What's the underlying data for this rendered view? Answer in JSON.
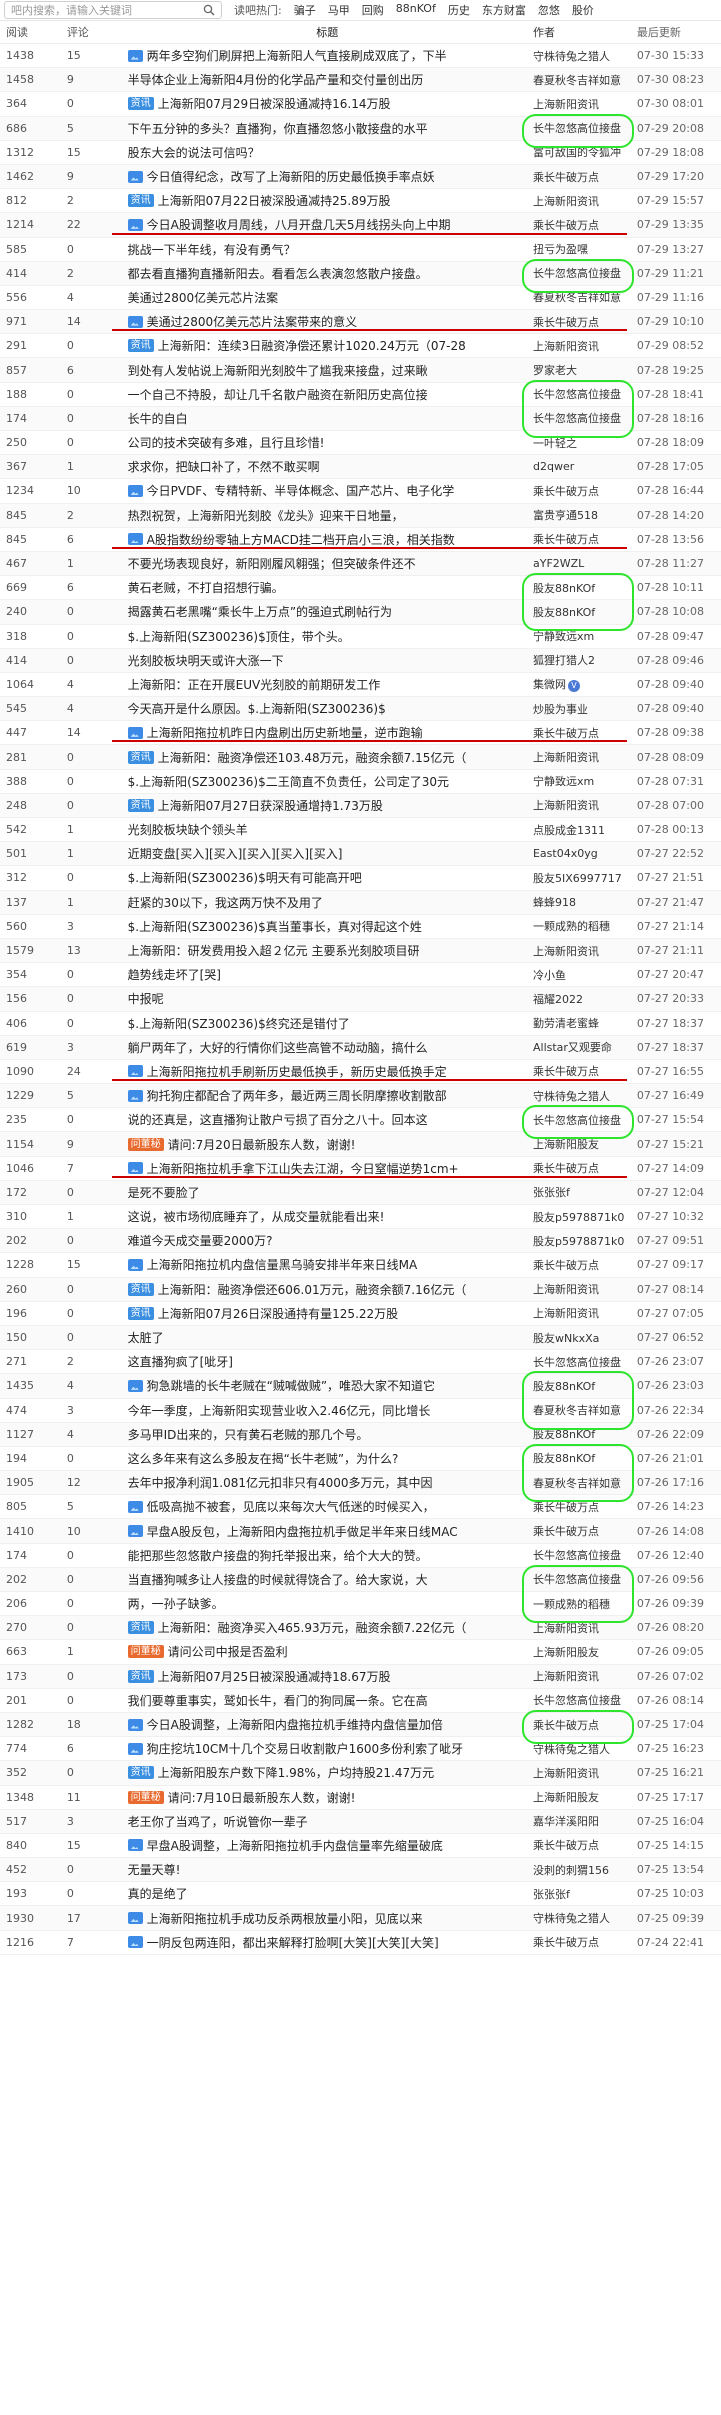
{
  "search": {
    "placeholder": "吧内搜索，请输入关键词"
  },
  "hot": {
    "label": "读吧热门:",
    "links": [
      "骗子",
      "马甲",
      "回购",
      "88nKOf",
      "历史",
      "东方财富",
      "忽悠",
      "股价"
    ]
  },
  "header": {
    "read": "阅读",
    "comment": "评论",
    "title": "标题",
    "author": "作者",
    "time": "最后更新"
  },
  "rows": [
    {
      "read": "1438",
      "cmt": "15",
      "icon": "pic",
      "title": "两年多空狗们刷屏把上海新阳人气直接刷成双底了，下半",
      "author": "守株待兔之猎人",
      "time": "07-30 15:33"
    },
    {
      "read": "1458",
      "cmt": "9",
      "icon": "",
      "title": "半导体企业上海新阳4月份的化学品产量和交付量创出历",
      "author": "春夏秋冬吉祥如意",
      "time": "07-30 08:23"
    },
    {
      "read": "364",
      "cmt": "0",
      "icon": "info",
      "title": "上海新阳07月29日被深股通减持16.14万股",
      "author": "上海新阳资讯",
      "time": "07-30 08:01"
    },
    {
      "read": "686",
      "cmt": "5",
      "icon": "",
      "title": "下午五分钟的多头？直播狗，你直播忽悠小散接盘的水平",
      "author": "长牛忽悠高位接盘",
      "time": "07-29 20:08"
    },
    {
      "read": "1312",
      "cmt": "15",
      "icon": "",
      "title": "股东大会的说法可信吗？",
      "author": "富可敌国的令狐冲",
      "time": "07-29 18:08"
    },
    {
      "read": "1462",
      "cmt": "9",
      "icon": "pic",
      "title": "今日值得纪念，改写了上海新阳的历史最低换手率点妖",
      "author": "乘长牛破万点",
      "time": "07-29 17:20"
    },
    {
      "read": "812",
      "cmt": "2",
      "icon": "info",
      "title": "上海新阳07月22日被深股通减持25.89万股",
      "author": "上海新阳资讯",
      "time": "07-29 15:57"
    },
    {
      "read": "1214",
      "cmt": "22",
      "icon": "pic",
      "title": "今日A股调整收月周线，八月开盘几天5月线拐头向上中期",
      "author": "乘长牛破万点",
      "time": "07-29 13:35"
    },
    {
      "read": "585",
      "cmt": "0",
      "icon": "",
      "title": "挑战一下半年线，有没有勇气？",
      "author": "扭亏为盈嘿",
      "time": "07-29 13:27"
    },
    {
      "read": "414",
      "cmt": "2",
      "icon": "",
      "title": "都去看直播狗直播新阳去。看看怎么表演忽悠散户接盘。",
      "author": "长牛忽悠高位接盘",
      "time": "07-29 11:21"
    },
    {
      "read": "556",
      "cmt": "4",
      "icon": "",
      "title": "美通过2800亿美元芯片法案",
      "author": "春夏秋冬吉祥如意",
      "time": "07-29 11:16"
    },
    {
      "read": "971",
      "cmt": "14",
      "icon": "pic",
      "title": "美通过2800亿美元芯片法案带来的意义",
      "author": "乘长牛破万点",
      "time": "07-29 10:10"
    },
    {
      "read": "291",
      "cmt": "0",
      "icon": "info",
      "title": "上海新阳：连续3日融资净偿还累计1020.24万元（07-28",
      "author": "上海新阳资讯",
      "time": "07-29 08:52"
    },
    {
      "read": "857",
      "cmt": "6",
      "icon": "",
      "title": "到处有人发帖说上海新阳光刻胶牛了尴我来接盘，过来瞅",
      "author": "罗家老大",
      "time": "07-28 19:25"
    },
    {
      "read": "188",
      "cmt": "0",
      "icon": "",
      "title": "一个自己不持股，却让几千名散户融资在新阳历史高位接",
      "author": "长牛忽悠高位接盘",
      "time": "07-28 18:41"
    },
    {
      "read": "174",
      "cmt": "0",
      "icon": "",
      "title": "长牛的自白",
      "author": "长牛忽悠高位接盘",
      "time": "07-28 18:16"
    },
    {
      "read": "250",
      "cmt": "0",
      "icon": "",
      "title": "公司的技术突破有多难，且行且珍惜!",
      "author": "一叶轻之",
      "time": "07-28 18:09"
    },
    {
      "read": "367",
      "cmt": "1",
      "icon": "",
      "title": "求求你，把缺口补了，不然不敢买啊",
      "author": "d2qwer",
      "time": "07-28 17:05"
    },
    {
      "read": "1234",
      "cmt": "10",
      "icon": "pic",
      "title": "今日PVDF、专精特新、半导体概念、国产芯片、电子化学",
      "author": "乘长牛破万点",
      "time": "07-28 16:44"
    },
    {
      "read": "845",
      "cmt": "2",
      "icon": "",
      "title": "热烈祝贺，上海新阳光刻胶《龙头》迎来干日地量，",
      "author": "富贵亨通518",
      "time": "07-28 14:20"
    },
    {
      "read": "845",
      "cmt": "6",
      "icon": "pic",
      "title": "A股指数纷纷零轴上方MACD挂二档开启小三浪，相关指数",
      "author": "乘长牛破万点",
      "time": "07-28 13:56"
    },
    {
      "read": "467",
      "cmt": "1",
      "icon": "",
      "title": "不要光场表现良好，新阳刚履风翱强；但突破条件还不",
      "author": "aYF2WZL",
      "time": "07-28 11:27"
    },
    {
      "read": "669",
      "cmt": "6",
      "icon": "",
      "title": "黄石老贼，不打自招想行骗。",
      "author": "股友88nKOf",
      "time": "07-28 10:11"
    },
    {
      "read": "240",
      "cmt": "0",
      "icon": "",
      "title": "揭露黄石老黑嘴“乘长牛上万点”的强迫式刷帖行为",
      "author": "股友88nKOf",
      "time": "07-28 10:08"
    },
    {
      "read": "318",
      "cmt": "0",
      "icon": "",
      "title": "$.上海新阳(SZ300236)$顶住，带个头。",
      "author": "宁静致远xm",
      "time": "07-28 09:47"
    },
    {
      "read": "414",
      "cmt": "0",
      "icon": "",
      "title": "光刻胶板块明天或许大涨一下",
      "author": "狐狸打猎人2",
      "time": "07-28 09:46"
    },
    {
      "read": "1064",
      "cmt": "4",
      "icon": "",
      "title": "上海新阳：正在开展EUV光刻胶的前期研发工作",
      "author": "集微网",
      "time": "07-28 09:40"
    },
    {
      "read": "545",
      "cmt": "4",
      "icon": "",
      "title": "今天高开是什么原因。$.上海新阳(SZ300236)$",
      "author": "炒股为事业",
      "time": "07-28 09:40"
    },
    {
      "read": "447",
      "cmt": "14",
      "icon": "pic",
      "title": "上海新阳拖拉机昨日内盘刷出历史新地量，逆市跑输",
      "author": "乘长牛破万点",
      "time": "07-28 09:38"
    },
    {
      "read": "281",
      "cmt": "0",
      "icon": "info",
      "title": "上海新阳：融资净偿还103.48万元，融资余额7.15亿元（",
      "author": "上海新阳资讯",
      "time": "07-28 08:09"
    },
    {
      "read": "388",
      "cmt": "0",
      "icon": "",
      "title": "$.上海新阳(SZ300236)$二王简直不负责任，公司定了30元",
      "author": "宁静致远xm",
      "time": "07-28 07:31"
    },
    {
      "read": "248",
      "cmt": "0",
      "icon": "info",
      "title": "上海新阳07月27日获深股通增持1.73万股",
      "author": "上海新阳资讯",
      "time": "07-28 07:00"
    },
    {
      "read": "542",
      "cmt": "1",
      "icon": "",
      "title": "光刻胶板块缺个领头羊",
      "author": "点股成金1311",
      "time": "07-28 00:13"
    },
    {
      "read": "501",
      "cmt": "1",
      "icon": "",
      "title": "近期变盘[买入][买入][买入][买入][买入]",
      "author": "East04x0yg",
      "time": "07-27 22:52"
    },
    {
      "read": "312",
      "cmt": "0",
      "icon": "",
      "title": "$.上海新阳(SZ300236)$明天有可能高开吧",
      "author": "股友5IX6997717",
      "time": "07-27 21:51"
    },
    {
      "read": "137",
      "cmt": "1",
      "icon": "",
      "title": "赶紧的30以下，我这两万快不及用了",
      "author": "蜂蜂918",
      "time": "07-27 21:47"
    },
    {
      "read": "560",
      "cmt": "3",
      "icon": "",
      "title": "$.上海新阳(SZ300236)$真当董事长，真对得起这个姓",
      "author": "一颗成熟的稻穗",
      "time": "07-27 21:14"
    },
    {
      "read": "1579",
      "cmt": "13",
      "icon": "",
      "title": "上海新阳：研发费用投入超２亿元 主要系光刻胶项目研",
      "author": "上海新阳资讯",
      "time": "07-27 21:11"
    },
    {
      "read": "354",
      "cmt": "0",
      "icon": "",
      "title": "趋势线走坏了[哭]",
      "author": "冷小鱼",
      "time": "07-27 20:47"
    },
    {
      "read": "156",
      "cmt": "0",
      "icon": "",
      "title": "中报呢",
      "author": "福耀2022",
      "time": "07-27 20:33"
    },
    {
      "read": "406",
      "cmt": "0",
      "icon": "",
      "title": "$.上海新阳(SZ300236)$终究还是错付了",
      "author": "勤劳清老蜜蜂",
      "time": "07-27 18:37"
    },
    {
      "read": "619",
      "cmt": "3",
      "icon": "",
      "title": "躺尸两年了，大好的行情你们这些高管不动动脑，搞什么",
      "author": "Allstar又观要命",
      "time": "07-27 18:37"
    },
    {
      "read": "1090",
      "cmt": "24",
      "icon": "pic",
      "title": "上海新阳拖拉机手刷新历史最低换手，新历史最低换手定",
      "author": "乘长牛破万点",
      "time": "07-27 16:55"
    },
    {
      "read": "1229",
      "cmt": "5",
      "icon": "pic",
      "title": "狗托狗庄都配合了两年多，最近两三周长阴摩擦收割散部",
      "author": "守株待兔之猎人",
      "time": "07-27 16:49"
    },
    {
      "read": "235",
      "cmt": "0",
      "icon": "",
      "title": "说的还真是，这直播狗让散户亏损了百分之八十。回本这",
      "author": "长牛忽悠高位接盘",
      "time": "07-27 15:54"
    },
    {
      "read": "1154",
      "cmt": "9",
      "icon": "qa",
      "title": "请问:7月20日最新股东人数，谢谢!",
      "author": "上海新阳股友",
      "time": "07-27 15:21"
    },
    {
      "read": "1046",
      "cmt": "7",
      "icon": "pic",
      "title": "上海新阳拖拉机手拿下江山失去江湖，今日窒幅逆势1cm+",
      "author": "乘长牛破万点",
      "time": "07-27 14:09"
    },
    {
      "read": "172",
      "cmt": "0",
      "icon": "",
      "title": "是死不要脸了",
      "author": "张张张f",
      "time": "07-27 12:04"
    },
    {
      "read": "310",
      "cmt": "1",
      "icon": "",
      "title": "这说，被市场彻底睡弃了，从成交量就能看出来!",
      "author": "股友p5978871k0",
      "time": "07-27 10:32"
    },
    {
      "read": "202",
      "cmt": "0",
      "icon": "",
      "title": "难道今天成交量要2000万?",
      "author": "股友p5978871k0",
      "time": "07-27 09:51"
    },
    {
      "read": "1228",
      "cmt": "15",
      "icon": "pic",
      "title": "上海新阳拖拉机内盘信量黑乌骑安排半年来日线MA",
      "author": "乘长牛破万点",
      "time": "07-27 09:17"
    },
    {
      "read": "260",
      "cmt": "0",
      "icon": "info",
      "title": "上海新阳：融资净偿还606.01万元，融资余额7.16亿元（",
      "author": "上海新阳资讯",
      "time": "07-27 08:14"
    },
    {
      "read": "196",
      "cmt": "0",
      "icon": "info",
      "title": "上海新阳07月26日深股通持有量125.22万股",
      "author": "上海新阳资讯",
      "time": "07-27 07:05"
    },
    {
      "read": "150",
      "cmt": "0",
      "icon": "",
      "title": "太脏了",
      "author": "股友wNkxXa",
      "time": "07-27 06:52"
    },
    {
      "read": "271",
      "cmt": "2",
      "icon": "",
      "title": "这直播狗疯了[呲牙]",
      "author": "长牛忽悠高位接盘",
      "time": "07-26 23:07"
    },
    {
      "read": "1435",
      "cmt": "4",
      "icon": "pic",
      "title": "狗急跳墙的长牛老贼在“贼喊做贼”，唯恐大家不知道它",
      "author": "股友88nKOf",
      "time": "07-26 23:03"
    },
    {
      "read": "474",
      "cmt": "3",
      "icon": "",
      "title": "今年一季度，上海新阳实现营业收入2.46亿元，同比增长",
      "author": "春夏秋冬吉祥如意",
      "time": "07-26 22:34"
    },
    {
      "read": "1127",
      "cmt": "4",
      "icon": "",
      "title": "多马甲ID出来的，只有黄石老贼的那几个号。",
      "author": "股友88nKOf",
      "time": "07-26 22:09"
    },
    {
      "read": "194",
      "cmt": "0",
      "icon": "",
      "title": "这么多年来有这么多股友在揭“长牛老贼”，为什么?",
      "author": "股友88nKOf",
      "time": "07-26 21:01"
    },
    {
      "read": "1905",
      "cmt": "12",
      "icon": "",
      "title": "去年中报净利润1.081亿元扣非只有4000多万元，其中因",
      "author": "春夏秋冬吉祥如意",
      "time": "07-26 17:16"
    },
    {
      "read": "805",
      "cmt": "5",
      "icon": "pic",
      "title": "低吸高抛不被套，见底以来每次大气低迷的时候买入，",
      "author": "乘长牛破万点",
      "time": "07-26 14:23"
    },
    {
      "read": "1410",
      "cmt": "10",
      "icon": "pic",
      "title": "早盘A股反包，上海新阳内盘拖拉机手做足半年来日线MAC",
      "author": "乘长牛破万点",
      "time": "07-26 14:08"
    },
    {
      "read": "174",
      "cmt": "0",
      "icon": "",
      "title": "能把那些忽悠散户接盘的狗托举报出来，给个大大的赞。",
      "author": "长牛忽悠高位接盘",
      "time": "07-26 12:40"
    },
    {
      "read": "202",
      "cmt": "0",
      "icon": "",
      "title": "当直播狗喊多让人接盘的时候就得饶合了。给大家说，大",
      "author": "长牛忽悠高位接盘",
      "time": "07-26 09:56"
    },
    {
      "read": "206",
      "cmt": "0",
      "icon": "",
      "title": "两，一孙子缺爹。",
      "author": "一颗成熟的稻穗",
      "time": "07-26 09:39"
    },
    {
      "read": "270",
      "cmt": "0",
      "icon": "info",
      "title": "上海新阳：融资净买入465.93万元，融资余额7.22亿元（",
      "author": "上海新阳资讯",
      "time": "07-26 08:20"
    },
    {
      "read": "663",
      "cmt": "1",
      "icon": "qa",
      "title": "请问公司中报是否盈利",
      "author": "上海新阳股友",
      "time": "07-26 09:05"
    },
    {
      "read": "173",
      "cmt": "0",
      "icon": "info",
      "title": "上海新阳07月25日被深股通减持18.67万股",
      "author": "上海新阳资讯",
      "time": "07-26 07:02"
    },
    {
      "read": "201",
      "cmt": "0",
      "icon": "",
      "title": "我们要尊重事实，鹫如长牛，看门的狗同属一条。它在高",
      "author": "长牛忽悠高位接盘",
      "time": "07-26 08:14"
    },
    {
      "read": "1282",
      "cmt": "18",
      "icon": "pic",
      "title": "今日A股调整，上海新阳内盘拖拉机手维持内盘信量加倍",
      "author": "乘长牛破万点",
      "time": "07-25 17:04"
    },
    {
      "read": "774",
      "cmt": "6",
      "icon": "pic",
      "title": "狗庄挖坑10CM十几个交易日收割散户1600多份利索了呲牙",
      "author": "守株待兔之猎人",
      "time": "07-25 16:23"
    },
    {
      "read": "352",
      "cmt": "0",
      "icon": "info",
      "title": "上海新阳股东户数下降1.98%，户均持股21.47万元",
      "author": "上海新阳资讯",
      "time": "07-25 16:21"
    },
    {
      "read": "1348",
      "cmt": "11",
      "icon": "qa",
      "title": "请问:7月10日最新股东人数，谢谢!",
      "author": "上海新阳股友",
      "time": "07-25 17:17"
    },
    {
      "read": "517",
      "cmt": "3",
      "icon": "",
      "title": "老王你了当鸡了，听说管你一辈子",
      "author": "嘉华洋溪阳阳",
      "time": "07-25 16:04"
    },
    {
      "read": "840",
      "cmt": "15",
      "icon": "pic",
      "title": "早盘A股调整，上海新阳拖拉机手内盘信量率先缩量破底",
      "author": "乘长牛破万点",
      "time": "07-25 14:15"
    },
    {
      "read": "452",
      "cmt": "0",
      "icon": "",
      "title": "无量天尊!",
      "author": "没刺的刺猬156",
      "time": "07-25 13:54"
    },
    {
      "read": "193",
      "cmt": "0",
      "icon": "",
      "title": "真的是绝了",
      "author": "张张张f",
      "time": "07-25 10:03"
    },
    {
      "read": "1930",
      "cmt": "17",
      "icon": "pic",
      "title": "上海新阳拖拉机手成功反杀两根放量小阳，见底以来",
      "author": "守株待兔之猎人",
      "time": "07-25 09:39"
    },
    {
      "read": "1216",
      "cmt": "7",
      "icon": "pic",
      "title": "一阴反包两连阳，都出来解释打脸啊[大笑][大笑][大笑]",
      "author": "乘长牛破万点",
      "time": "07-24 22:41"
    }
  ]
}
